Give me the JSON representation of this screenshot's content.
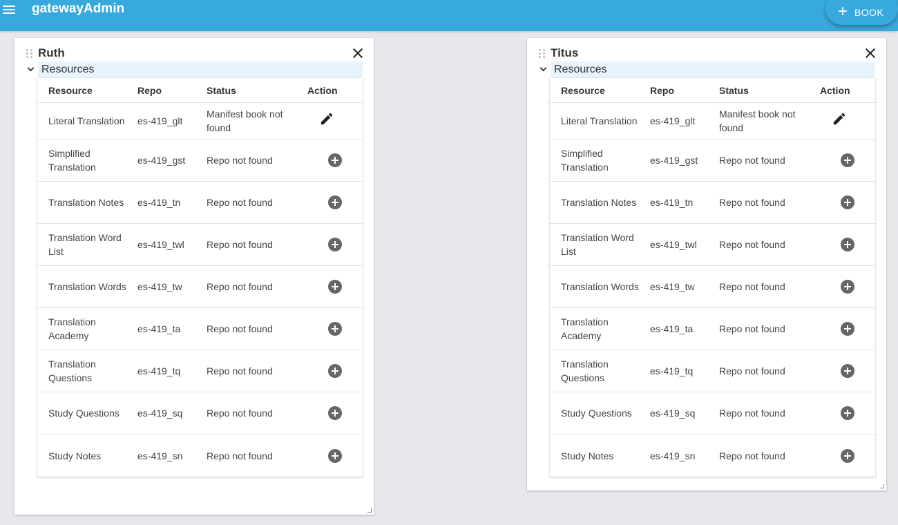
{
  "appbar": {
    "title": "gatewayAdmin",
    "book_button_plus": "+",
    "book_button_label": "BOOK"
  },
  "cards": [
    {
      "title": "Ruth",
      "section_label": "Resources",
      "columns": [
        "Resource",
        "Repo",
        "Status",
        "Action"
      ],
      "rows": [
        {
          "resource": "Literal Translation",
          "repo": "es-419_glt",
          "status": "Manifest book not found",
          "action": "edit-icon"
        },
        {
          "resource": "Simplified Translation",
          "repo": "es-419_gst",
          "status": "Repo not found",
          "action": "add-circle-icon"
        },
        {
          "resource": "Translation Notes",
          "repo": "es-419_tn",
          "status": "Repo not found",
          "action": "add-circle-icon"
        },
        {
          "resource": "Translation Word List",
          "repo": "es-419_twl",
          "status": "Repo not found",
          "action": "add-circle-icon"
        },
        {
          "resource": "Translation Words",
          "repo": "es-419_tw",
          "status": "Repo not found",
          "action": "add-circle-icon"
        },
        {
          "resource": "Translation Academy",
          "repo": "es-419_ta",
          "status": "Repo not found",
          "action": "add-circle-icon"
        },
        {
          "resource": "Translation Questions",
          "repo": "es-419_tq",
          "status": "Repo not found",
          "action": "add-circle-icon"
        },
        {
          "resource": "Study Questions",
          "repo": "es-419_sq",
          "status": "Repo not found",
          "action": "add-circle-icon"
        },
        {
          "resource": "Study Notes",
          "repo": "es-419_sn",
          "status": "Repo not found",
          "action": "add-circle-icon"
        }
      ]
    },
    {
      "title": "Titus",
      "section_label": "Resources",
      "columns": [
        "Resource",
        "Repo",
        "Status",
        "Action"
      ],
      "rows": [
        {
          "resource": "Literal Translation",
          "repo": "es-419_glt",
          "status": "Manifest book not found",
          "action": "edit-icon"
        },
        {
          "resource": "Simplified Translation",
          "repo": "es-419_gst",
          "status": "Repo not found",
          "action": "add-circle-icon"
        },
        {
          "resource": "Translation Notes",
          "repo": "es-419_tn",
          "status": "Repo not found",
          "action": "add-circle-icon"
        },
        {
          "resource": "Translation Word List",
          "repo": "es-419_twl",
          "status": "Repo not found",
          "action": "add-circle-icon"
        },
        {
          "resource": "Translation Words",
          "repo": "es-419_tw",
          "status": "Repo not found",
          "action": "add-circle-icon"
        },
        {
          "resource": "Translation Academy",
          "repo": "es-419_ta",
          "status": "Repo not found",
          "action": "add-circle-icon"
        },
        {
          "resource": "Translation Questions",
          "repo": "es-419_tq",
          "status": "Repo not found",
          "action": "add-circle-icon"
        },
        {
          "resource": "Study Questions",
          "repo": "es-419_sq",
          "status": "Repo not found",
          "action": "add-circle-icon"
        },
        {
          "resource": "Study Notes",
          "repo": "es-419_sn",
          "status": "Repo not found",
          "action": "add-circle-icon"
        }
      ]
    }
  ],
  "colors": {
    "appbar": "#38a9dd",
    "section_header_bg": "#e8f4fb",
    "page_bg": "#e8e8ec"
  }
}
